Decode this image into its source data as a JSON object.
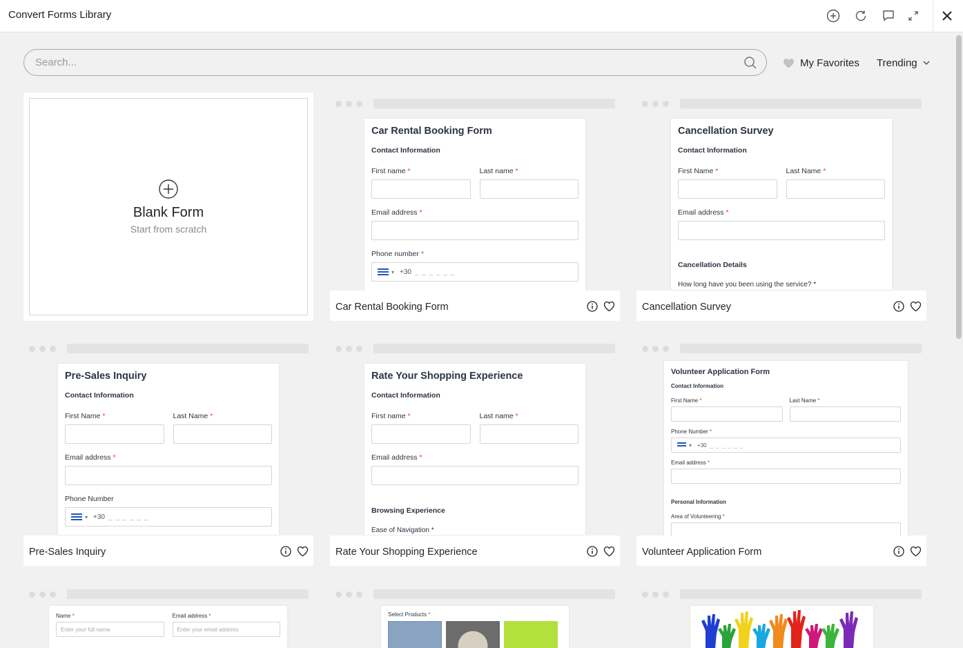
{
  "window": {
    "title": "Convert Forms Library"
  },
  "toolbar": {
    "search_placeholder": "Search...",
    "favorites_label": "My Favorites",
    "sort_label": "Trending"
  },
  "blank": {
    "title": "Blank Form",
    "subtitle": "Start from scratch"
  },
  "templates": {
    "car": {
      "name": "Car Rental Booking Form",
      "form_title": "Car Rental Booking Form",
      "section": "Contact Information",
      "first": "First name",
      "last": "Last name",
      "email": "Email address",
      "phone": "Phone number",
      "code": "+30",
      "mask": "_ _ _ _ _ _"
    },
    "cancel": {
      "name": "Cancellation Survey",
      "form_title": "Cancellation Survey",
      "section": "Contact Information",
      "first": "First Name",
      "last": "Last Name",
      "email": "Email address",
      "details": "Cancellation Details",
      "question": "How long have you been using the service?"
    },
    "presales": {
      "name": "Pre-Sales Inquiry",
      "form_title": "Pre-Sales Inquiry",
      "section": "Contact Information",
      "first": "First Name",
      "last": "Last Name",
      "email": "Email address",
      "phone": "Phone Number",
      "code": "+30",
      "mask": "_ _ _ _ _ _"
    },
    "rate": {
      "name": "Rate Your Shopping Experience",
      "form_title": "Rate Your Shopping Experience",
      "section": "Contact Information",
      "first": "First name",
      "last": "Last name",
      "email": "Email address",
      "browsing": "Browsing Experience",
      "question": "Ease of Navigation"
    },
    "volunteer": {
      "name": "Volunteer Application Form",
      "form_title": "Volunteer Application Form",
      "section": "Contact Information",
      "first": "First Name",
      "last": "Last Name",
      "phone": "Phone Number",
      "code": "+30",
      "mask": "_ _ _ _ _ _",
      "email": "Email address",
      "personal": "Personal Information",
      "area": "Area of Volunteering"
    },
    "contact": {
      "name_label": "Name",
      "name_ph": "Enter your full name",
      "email_label": "Email address",
      "email_ph": "Enter your email address"
    },
    "products": {
      "label": "Select Products"
    }
  },
  "colors": {
    "required": "#e53935",
    "accent": "#2b3440"
  }
}
